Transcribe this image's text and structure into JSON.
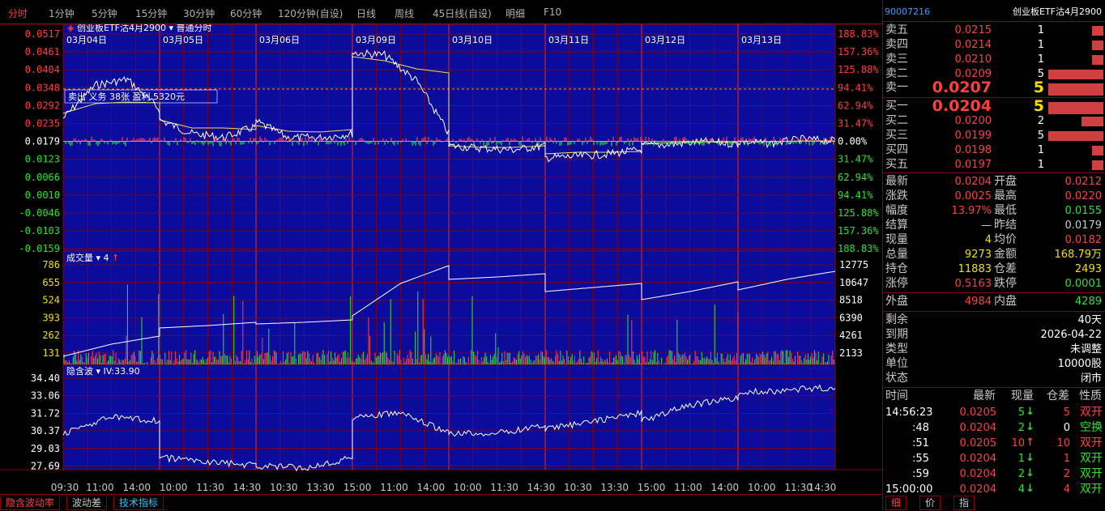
{
  "timeframe_tabs": [
    "分时",
    "1分钟",
    "5分钟",
    "15分钟",
    "30分钟",
    "60分钟",
    "120分钟(自设)",
    "日线",
    "周线",
    "45日线(自设)",
    "明细",
    "F10"
  ],
  "chart": {
    "title": "创业板ETF沽4月2900",
    "mode": "普通分时",
    "dates": [
      "03月04日",
      "03月05日",
      "03月06日",
      "03月09日",
      "03月10日",
      "03月11日",
      "03月12日",
      "03月13日"
    ],
    "price_ticks": [
      "0.0517",
      "0.0461",
      "0.0404",
      "0.0348",
      "0.0292",
      "0.0235",
      "0.0179",
      "0.0123",
      "0.0066",
      "0.0010",
      "-0.0046",
      "-0.0103",
      "-0.0159"
    ],
    "pct_ticks": [
      "188.83%",
      "157.36%",
      "125.88%",
      "94.41%",
      "62.94%",
      "31.47%",
      "0.00%",
      "31.47%",
      "62.94%",
      "94.41%",
      "125.88%",
      "157.36%",
      "188.83%"
    ],
    "position_note": "卖出 义务 38张 盈利 5320元",
    "volume_label": "成交量",
    "volume_value": "4",
    "volume_ticks": [
      "786",
      "655",
      "524",
      "393",
      "262",
      "131"
    ],
    "oi_ticks": [
      "12775",
      "10647",
      "8518",
      "6390",
      "4261",
      "2133"
    ],
    "iv_label": "隐含波",
    "iv_value": "IV:33.90",
    "iv_ticks": [
      "34.40",
      "33.06",
      "31.72",
      "30.37",
      "29.03",
      "27.69"
    ],
    "time_ticks": [
      "09:30",
      "11:00",
      "14:00",
      "10:00",
      "11:30",
      "14:30",
      "10:30",
      "13:30",
      "15:00",
      "11:00",
      "14:00",
      "10:00",
      "11:30",
      "14:30",
      "10:30",
      "13:30",
      "15:00",
      "11:00",
      "14:00",
      "10:00",
      "11:30",
      "14:30"
    ]
  },
  "bottom_tabs": [
    "隐含波动率",
    "波动差",
    "技术指标"
  ],
  "quote": {
    "code": "90007216",
    "name": "创业板ETF沽4月2900",
    "asks": [
      {
        "label": "卖五",
        "price": "0.0215",
        "qty": "1",
        "bar": 0.2
      },
      {
        "label": "卖四",
        "price": "0.0214",
        "qty": "1",
        "bar": 0.2
      },
      {
        "label": "卖三",
        "price": "0.0210",
        "qty": "1",
        "bar": 0.2
      },
      {
        "label": "卖二",
        "price": "0.0209",
        "qty": "5",
        "bar": 1.0
      },
      {
        "label": "卖一",
        "price": "0.0207",
        "qty": "5",
        "bar": 1.0
      }
    ],
    "bids": [
      {
        "label": "买一",
        "price": "0.0204",
        "qty": "5",
        "bar": 1.0
      },
      {
        "label": "买二",
        "price": "0.0200",
        "qty": "2",
        "bar": 0.4
      },
      {
        "label": "买三",
        "price": "0.0199",
        "qty": "5",
        "bar": 1.0
      },
      {
        "label": "买四",
        "price": "0.0198",
        "qty": "1",
        "bar": 0.2
      },
      {
        "label": "买五",
        "price": "0.0197",
        "qty": "1",
        "bar": 0.2
      }
    ],
    "stats": [
      {
        "l1": "最新",
        "v1": "0.0204",
        "c1": "red",
        "l2": "开盘",
        "v2": "0.0212",
        "c2": "red"
      },
      {
        "l1": "涨跌",
        "v1": "0.0025",
        "c1": "red",
        "l2": "最高",
        "v2": "0.0220",
        "c2": "red"
      },
      {
        "l1": "幅度",
        "v1": "13.97%",
        "c1": "red",
        "l2": "最低",
        "v2": "0.0155",
        "c2": "green"
      },
      {
        "l1": "结算",
        "v1": "—",
        "c1": "gray",
        "l2": "昨结",
        "v2": "0.0179",
        "c2": "gray"
      },
      {
        "l1": "现量",
        "v1": "4",
        "c1": "yellow",
        "l2": "均价",
        "v2": "0.0182",
        "c2": "red"
      },
      {
        "l1": "总量",
        "v1": "9273",
        "c1": "yellow",
        "l2": "金额",
        "v2": "168.79万",
        "c2": "yellow"
      },
      {
        "l1": "持仓",
        "v1": "11883",
        "c1": "yellow",
        "l2": "仓差",
        "v2": "2493",
        "c2": "yellow"
      },
      {
        "l1": "涨停",
        "v1": "0.5163",
        "c1": "red",
        "l2": "跌停",
        "v2": "0.0001",
        "c2": "green"
      }
    ],
    "outer_label": "外盘",
    "outer_value": "4984",
    "inner_label": "内盘",
    "inner_value": "4289",
    "info": [
      {
        "label": "剩余",
        "value": "40天"
      },
      {
        "label": "到期",
        "value": "2026-04-22"
      },
      {
        "label": "类型",
        "value": "未调整"
      },
      {
        "label": "单位",
        "value": "10000股"
      },
      {
        "label": "状态",
        "value": "闭市"
      }
    ],
    "trades_header": [
      "时间",
      "最新",
      "现量",
      "仓差",
      "性质"
    ],
    "trades": [
      {
        "time": "14:56:23",
        "price": "0.0205",
        "qty": "5",
        "dir": "down",
        "diff": "5",
        "nature": "双开",
        "pc": "red",
        "nc": "red"
      },
      {
        "time": ":48",
        "price": "0.0204",
        "qty": "2",
        "dir": "down",
        "diff": "0",
        "nature": "空换",
        "pc": "red",
        "nc": "green"
      },
      {
        "time": ":51",
        "price": "0.0205",
        "qty": "10",
        "dir": "up",
        "diff": "10",
        "nature": "双开",
        "pc": "red",
        "nc": "red"
      },
      {
        "time": ":55",
        "price": "0.0204",
        "qty": "1",
        "dir": "down",
        "diff": "1",
        "nature": "双开",
        "pc": "red",
        "nc": "green"
      },
      {
        "time": ":59",
        "price": "0.0204",
        "qty": "2",
        "dir": "down",
        "diff": "2",
        "nature": "双开",
        "pc": "red",
        "nc": "green"
      },
      {
        "time": "15:00:00",
        "price": "0.0204",
        "qty": "4",
        "dir": "down",
        "diff": "4",
        "nature": "双开",
        "pc": "red",
        "nc": "green"
      }
    ],
    "right_bottom_tabs": [
      "细",
      "价",
      "指"
    ]
  },
  "colors": {
    "panel_bg": "#0c0c9c",
    "grid": "#8b0000",
    "price_line": "#ffffff",
    "avg_line": "#f0e060",
    "up": "#ff4040",
    "down": "#30e030"
  }
}
